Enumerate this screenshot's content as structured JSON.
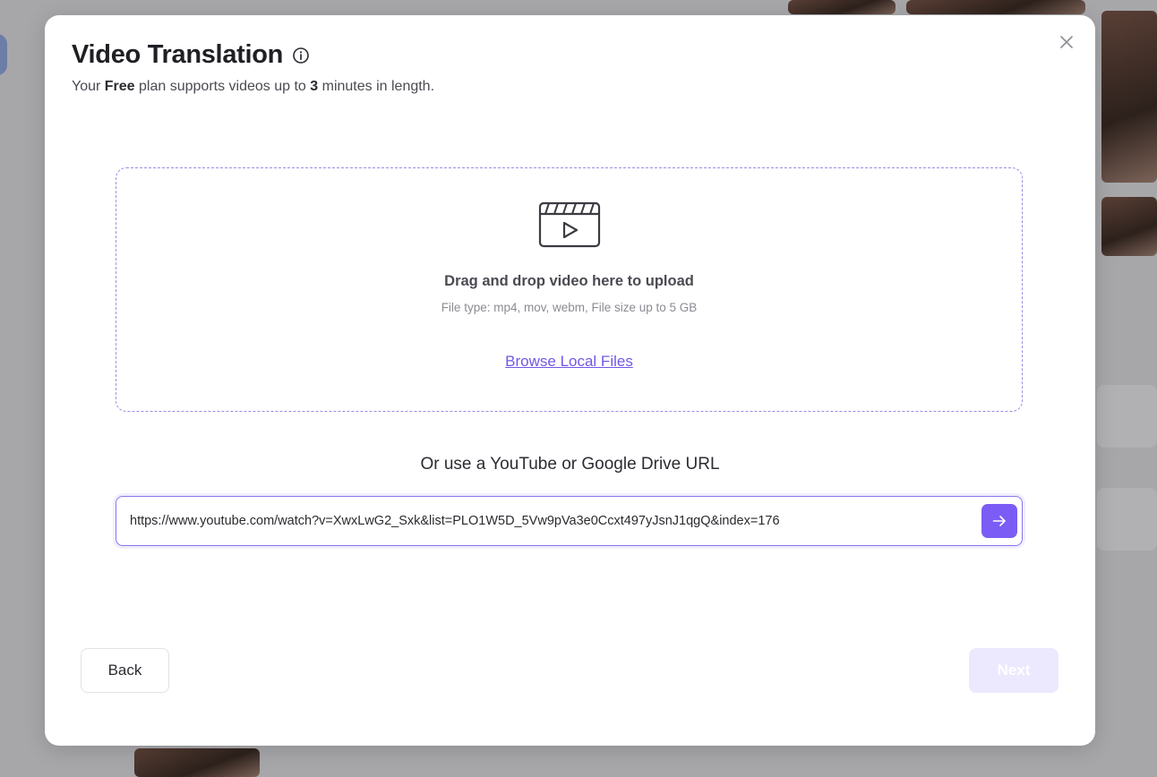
{
  "modal": {
    "title": "Video Translation",
    "subtitle": {
      "prefix": "Your ",
      "plan": "Free",
      "middle": " plan supports videos up to ",
      "limit": "3",
      "suffix": " minutes in length."
    }
  },
  "dropzone": {
    "title": "Drag and drop video here to upload",
    "hint": "File type: mp4, mov, webm, File size up to 5 GB",
    "browse_label": "Browse Local Files"
  },
  "url_section": {
    "heading": "Or use a YouTube or Google Drive URL",
    "value": "https://www.youtube.com/watch?v=XwxLwG2_Sxk&list=PLO1W5D_5Vw9pVa3e0Ccxt497yJsnJ1qgQ&index=176"
  },
  "footer": {
    "back_label": "Back",
    "next_label": "Next"
  },
  "colors": {
    "accent": "#7b5cf5",
    "link": "#7257e6",
    "next_disabled_bg": "#ece8fe"
  },
  "icons": {
    "close": "close-icon",
    "info": "info-icon",
    "upload": "video-clapper-icon",
    "submit": "arrow-right-icon"
  }
}
